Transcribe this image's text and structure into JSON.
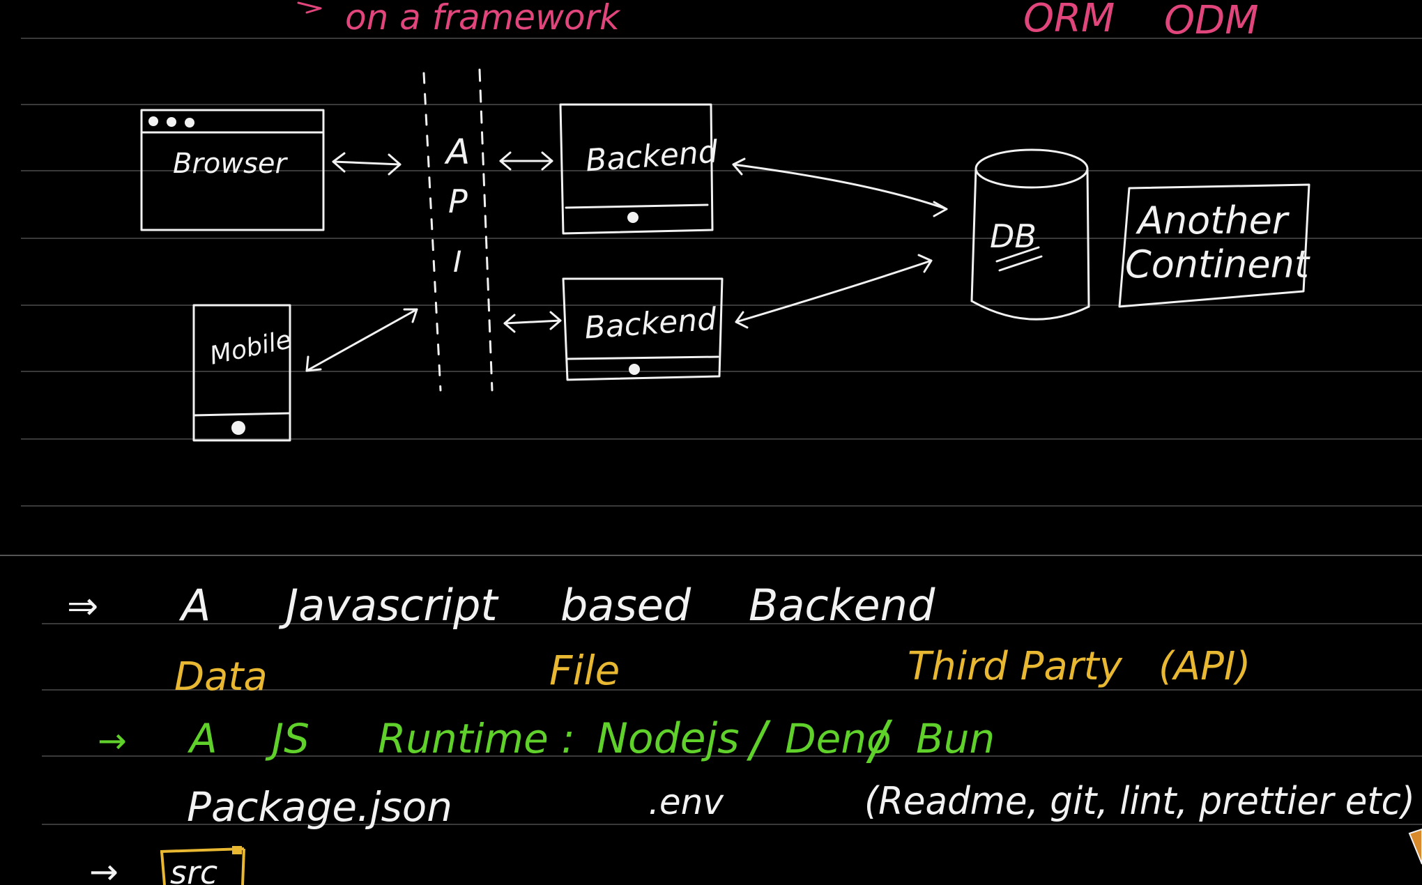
{
  "top": {
    "partial_note": "on a framework",
    "orm": "ORM",
    "odm": "ODM"
  },
  "diagram": {
    "browser": "Browser",
    "mobile": "Mobile",
    "api": [
      "A",
      "P",
      "I"
    ],
    "backend_1": "Backend",
    "backend_2": "Backend",
    "db": "DB",
    "another_line1": "Another",
    "another_line2": "Continent"
  },
  "notes": {
    "arrow_double": "⇒",
    "js_backend": [
      "A",
      "Javascript",
      "based",
      "Backend"
    ],
    "data": "Data",
    "file": "File",
    "third_party": "Third Party",
    "api_paren": "(API)",
    "arrow_single": "→",
    "runtime": [
      "A",
      "JS",
      "Runtime :"
    ],
    "runtimes": [
      "Nodejs",
      "/",
      "Deno",
      "/",
      "Bun"
    ],
    "package_json": "Package.json",
    "env": ".env",
    "extras": "(Readme, git, lint, prettier etc)",
    "src": "src"
  },
  "colors": {
    "background": "#000000",
    "ink": "#f2f2f2",
    "pink": "#e0457b",
    "yellow": "#e9b832",
    "green": "#5fd12a",
    "rule": "#3a3a3a"
  }
}
